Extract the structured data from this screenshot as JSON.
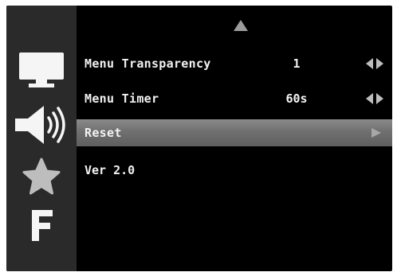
{
  "sidebar": {
    "items": [
      {
        "icon": "monitor-icon"
      },
      {
        "icon": "speaker-icon"
      },
      {
        "icon": "star-icon"
      },
      {
        "icon": "f-icon",
        "label": "F"
      }
    ]
  },
  "menu": {
    "scroll_up_icon": "triangle-up-icon",
    "rows": [
      {
        "label": "Menu Transparency",
        "value": "1",
        "control_icon": "left-right-arrows-icon"
      },
      {
        "label": "Menu Timer",
        "value": "60s",
        "control_icon": "left-right-arrows-icon"
      },
      {
        "label": "Reset",
        "value": "",
        "control_icon": "right-arrow-icon",
        "selected": true
      }
    ],
    "version": "Ver 2.0"
  },
  "colors": {
    "screen_background": "#000000",
    "sidebar_background": "#2a2a2a",
    "text": "#f2f2f2",
    "selection_highlight": "#707070",
    "icon_gray": "#bdbdbd",
    "icon_white": "#f5f5f5"
  }
}
